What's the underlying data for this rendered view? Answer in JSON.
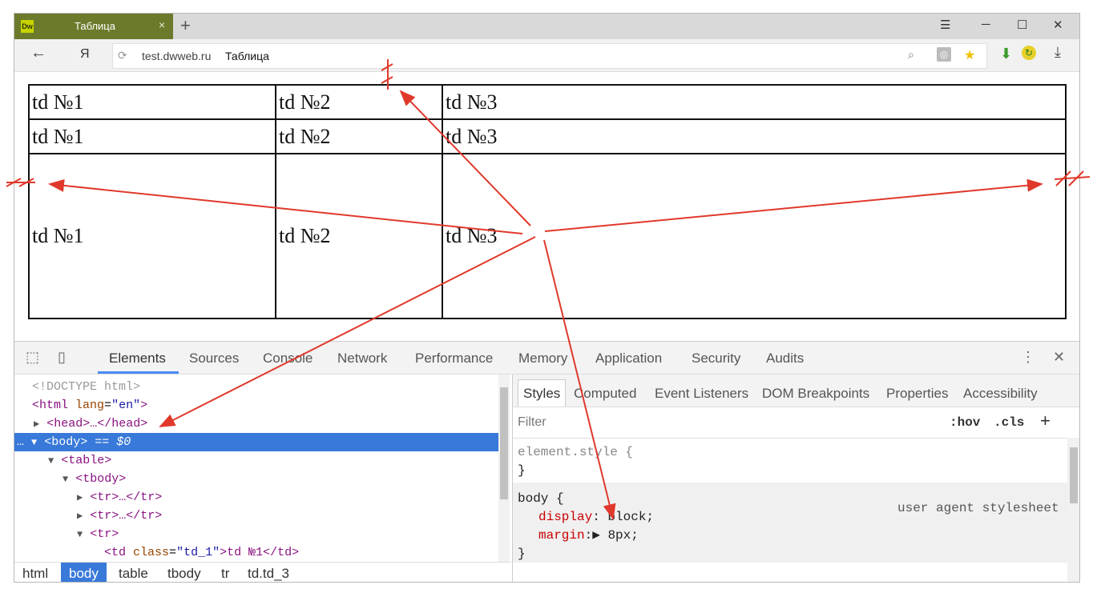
{
  "browser": {
    "tab_title": "Таблица",
    "tab_close": "×",
    "new_tab": "+",
    "menu_icon": "☰",
    "minimize": "─",
    "maximize": "☐",
    "close": "✕",
    "back": "←",
    "yandex_button": "Я",
    "domain": "test.dwweb.ru",
    "page_title": "Таблица",
    "favicon_text": "Dw"
  },
  "table": {
    "rows": [
      [
        "td №1",
        "td №2",
        "td №3"
      ],
      [
        "td №1",
        "td №2",
        "td №3"
      ],
      [
        "td №1",
        "td №2",
        "td №3"
      ]
    ]
  },
  "devtools": {
    "tabs": [
      "Elements",
      "Sources",
      "Console",
      "Network",
      "Performance",
      "Memory",
      "Application",
      "Security",
      "Audits"
    ],
    "active_tab": "Elements",
    "dom_lines": {
      "doctype": "<!DOCTYPE html>",
      "html_open": "<html",
      "lang_attr": "lang",
      "lang_val": "\"en\"",
      "html_close": ">",
      "head": "<head>…</head>",
      "body": "<body>",
      "body_suffix": " == $0",
      "table": "<table>",
      "tbody": "<tbody>",
      "tr_collapsed": "<tr>…</tr>",
      "tr_open": "<tr>",
      "td_open": "<td",
      "td_class_attr": "class",
      "td_class_val": "\"td_1\"",
      "td_text": ">td №1</td>"
    },
    "breadcrumbs": [
      "html",
      "body",
      "table",
      "tbody",
      "tr",
      "td.td_3"
    ],
    "active_breadcrumb": "body",
    "styles_tabs": [
      "Styles",
      "Computed",
      "Event Listeners",
      "DOM Breakpoints",
      "Properties",
      "Accessibility"
    ],
    "active_styles_tab": "Styles",
    "filter_placeholder": "Filter",
    "hov": ":hov",
    "cls": ".cls",
    "add": "+",
    "element_style": "element.style {",
    "close_brace": "}",
    "body_selector": "body {",
    "ua_label": "user agent stylesheet",
    "decl_display_prop": "display",
    "decl_display_val": ": block;",
    "decl_margin_prop": "margin",
    "decl_margin_val": ":▶ 8px;"
  },
  "colors": {
    "accent": "#3879d9",
    "annotation": "#e0392b",
    "tab_bg": "#6b7b2b"
  }
}
